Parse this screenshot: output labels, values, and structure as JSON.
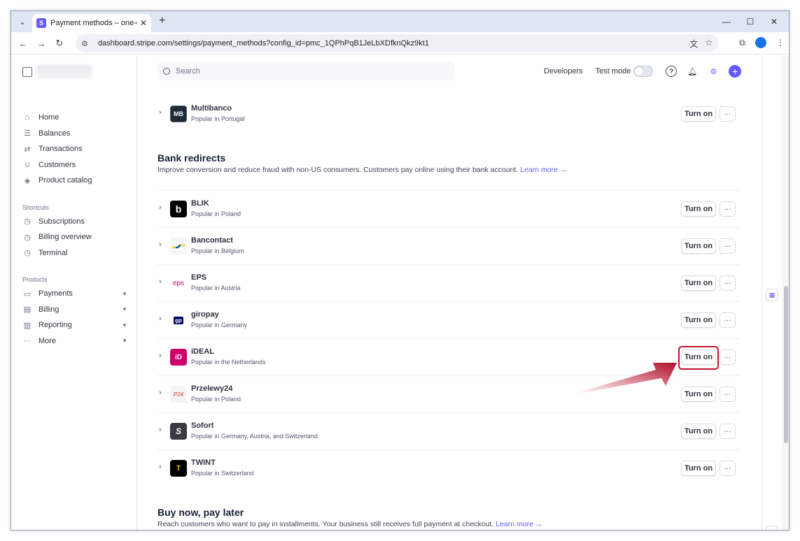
{
  "browser": {
    "tab_title": "Payment methods – one-examp",
    "url": "dashboard.stripe.com/settings/payment_methods?config_id=pmc_1QPhPqB1JeLbXDfknQkz9kt1"
  },
  "sidebar": {
    "items": [
      {
        "label": "Home",
        "icon": "home-icon"
      },
      {
        "label": "Balances",
        "icon": "balances-icon"
      },
      {
        "label": "Transactions",
        "icon": "transactions-icon"
      },
      {
        "label": "Customers",
        "icon": "customers-icon"
      },
      {
        "label": "Product catalog",
        "icon": "box-icon"
      }
    ],
    "shortcuts_label": "Shortcuts",
    "shortcuts": [
      {
        "label": "Subscriptions",
        "icon": "clock-icon"
      },
      {
        "label": "Billing overview",
        "icon": "clock-icon"
      },
      {
        "label": "Terminal",
        "icon": "clock-icon"
      }
    ],
    "products_label": "Products",
    "products": [
      {
        "label": "Payments",
        "icon": "payments-icon"
      },
      {
        "label": "Billing",
        "icon": "billing-icon"
      },
      {
        "label": "Reporting",
        "icon": "reporting-icon"
      },
      {
        "label": "More",
        "icon": "more-dots-icon"
      }
    ]
  },
  "header": {
    "search_placeholder": "Search",
    "developers": "Developers",
    "test_mode": "Test mode"
  },
  "top_row": {
    "name": "Multibanco",
    "sub": "Popular in Portugal",
    "logo_text": "MB"
  },
  "bank_redirects": {
    "title": "Bank redirects",
    "desc": "Improve conversion and reduce fraud with non-US consumers. Customers pay online using their bank account.",
    "learn_more": "Learn more →",
    "rows": [
      {
        "name": "BLIK",
        "sub": "Popular in Poland",
        "logo_text": "b"
      },
      {
        "name": "Bancontact",
        "sub": "Popular in Belgium",
        "logo_text": ""
      },
      {
        "name": "EPS",
        "sub": "Popular in Austria",
        "logo_text": "eps"
      },
      {
        "name": "giropay",
        "sub": "Popular in Germany",
        "logo_text": "gp"
      },
      {
        "name": "iDEAL",
        "sub": "Popular in the Netherlands",
        "logo_text": "iD"
      },
      {
        "name": "Przelewy24",
        "sub": "Popular in Poland",
        "logo_text": "P24"
      },
      {
        "name": "Sofort",
        "sub": "Popular in Germany, Austria, and Switzerland",
        "logo_text": "S"
      },
      {
        "name": "TWINT",
        "sub": "Popular in Switzerland",
        "logo_text": "T"
      }
    ]
  },
  "bnpl": {
    "title": "Buy now, pay later",
    "desc": "Reach customers who want to pay in installments. Your business still receives full payment at checkout.",
    "learn_more": "Learn more →"
  },
  "buttons": {
    "turn_on": "Turn on",
    "more": "···"
  },
  "colors": {
    "accent": "#635bff",
    "highlight": "#c0122c"
  }
}
